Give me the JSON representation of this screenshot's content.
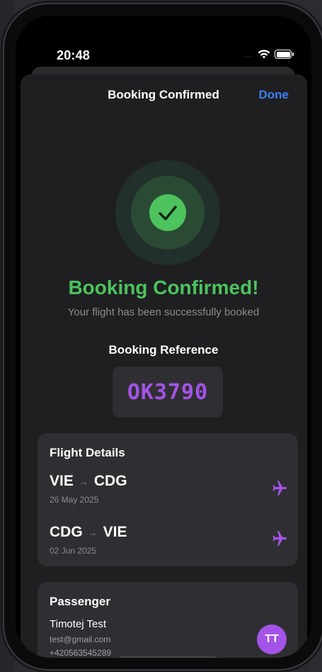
{
  "status_bar": {
    "time": "20:48",
    "cell_dots": "....",
    "wifi_icon": "wifi-icon",
    "battery_icon": "battery-icon"
  },
  "nav": {
    "title": "Booking Confirmed",
    "done_label": "Done"
  },
  "confirmation": {
    "icon": "checkmark-icon",
    "headline": "Booking Confirmed!",
    "subline": "Your flight has been successfully booked",
    "reference_label": "Booking Reference",
    "reference_code": "OK3790"
  },
  "flight_details": {
    "title": "Flight Details",
    "flights": [
      {
        "from": "VIE",
        "arrow": "→",
        "to": "CDG",
        "date": "26 May 2025",
        "icon": "airplane-icon"
      },
      {
        "from": "CDG",
        "arrow": "→",
        "to": "VIE",
        "date": "02 Jun 2025",
        "icon": "airplane-icon"
      }
    ]
  },
  "passenger": {
    "title": "Passenger",
    "name": "Timotej Test",
    "email": "test@gmail.com",
    "phone": "+420563545289",
    "initials": "TT"
  },
  "colors": {
    "accent_green": "#4cc35d",
    "accent_purple": "#a453e8",
    "link_blue": "#3d7ff5",
    "card_bg": "#2f2f33",
    "sheet_bg": "#1f1f21"
  }
}
